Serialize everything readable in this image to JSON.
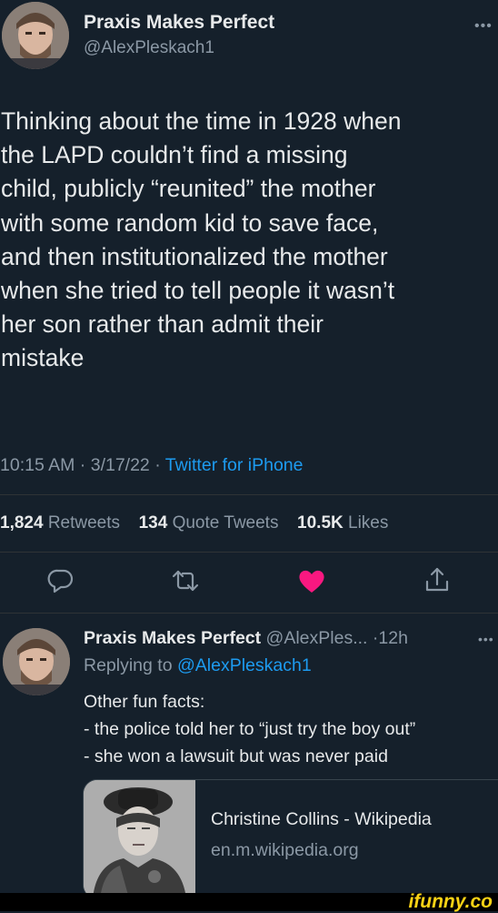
{
  "main_tweet": {
    "author_name": "Praxis Makes Perfect",
    "handle": "@AlexPleskach1",
    "text": "Thinking about the time in 1928 when\nthe LAPD couldn’t find a missing\nchild, publicly “reunited” the mother\nwith some random kid to save face,\nand then institutionalized the mother\nwhen she tried to tell people it wasn’t\nher son rather than admit their\nmistake",
    "time": "10:15 AM · 3/17/22 · ",
    "source": "Twitter for iPhone",
    "stats": {
      "retweets_count": "1,824",
      "retweets_label": "Retweets",
      "quotes_count": "134",
      "quotes_label": "Quote Tweets",
      "likes_count": "10.5K",
      "likes_label": "Likes"
    },
    "actions": {
      "reply_icon": "reply-icon",
      "retweet_icon": "retweet-icon",
      "like_icon": "heart-icon",
      "like_color": "#f91880",
      "share_icon": "share-icon"
    }
  },
  "reply_tweet": {
    "author_name": "Praxis Makes Perfect",
    "handle_truncated": "@AlexPles...",
    "age": "·12h",
    "replying_to_prefix": "Replying to ",
    "replying_to_handle": "@AlexPleskach1",
    "lines": [
      "Other fun facts:",
      "- the police told her to “just try the boy out”",
      "- she won a lawsuit but was never paid"
    ],
    "link_card": {
      "title": "Christine Collins - Wikipedia",
      "domain": "en.m.wikipedia.org"
    }
  },
  "watermark": {
    "text": "ifunny.co"
  },
  "colors": {
    "background": "#15202b",
    "accent": "#1d9bf0",
    "muted": "#8b98a5",
    "watermark": "#fbd315"
  }
}
